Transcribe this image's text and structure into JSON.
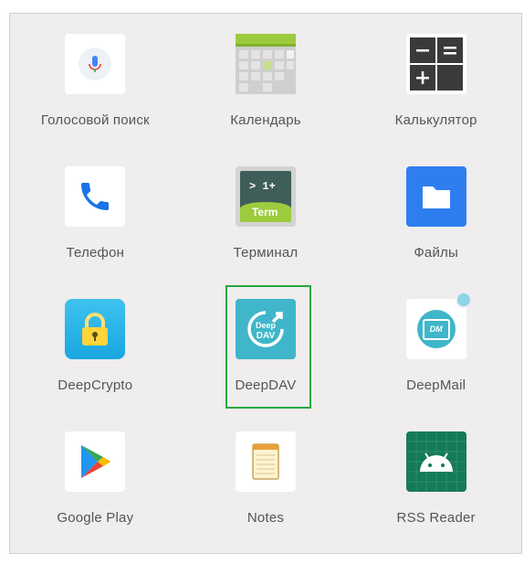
{
  "apps": [
    {
      "label": "Голосовой поиск",
      "icon": "microphone-icon"
    },
    {
      "label": "Календарь",
      "icon": "calendar-icon"
    },
    {
      "label": "Калькулятор",
      "icon": "calculator-icon"
    },
    {
      "label": "Телефон",
      "icon": "phone-icon"
    },
    {
      "label": "Терминал",
      "icon": "terminal-icon",
      "icon_text": [
        "> 1+",
        "Term"
      ]
    },
    {
      "label": "Файлы",
      "icon": "folder-icon"
    },
    {
      "label": "DeepCrypto",
      "icon": "lock-icon"
    },
    {
      "label": "DeepDAV",
      "icon": "sync-icon",
      "icon_text": [
        "Deep",
        "DAV"
      ],
      "selected": true
    },
    {
      "label": "DeepMail",
      "icon": "mail-icon",
      "icon_text": [
        "DM"
      ],
      "badge": true
    },
    {
      "label": "Google Play",
      "icon": "play-store-icon"
    },
    {
      "label": "Notes",
      "icon": "notepad-icon"
    },
    {
      "label": "RSS Reader",
      "icon": "android-icon"
    }
  ],
  "colors": {
    "selection_border": "#27a83d",
    "drawer_background": "#efeded",
    "label_text": "#555555"
  }
}
